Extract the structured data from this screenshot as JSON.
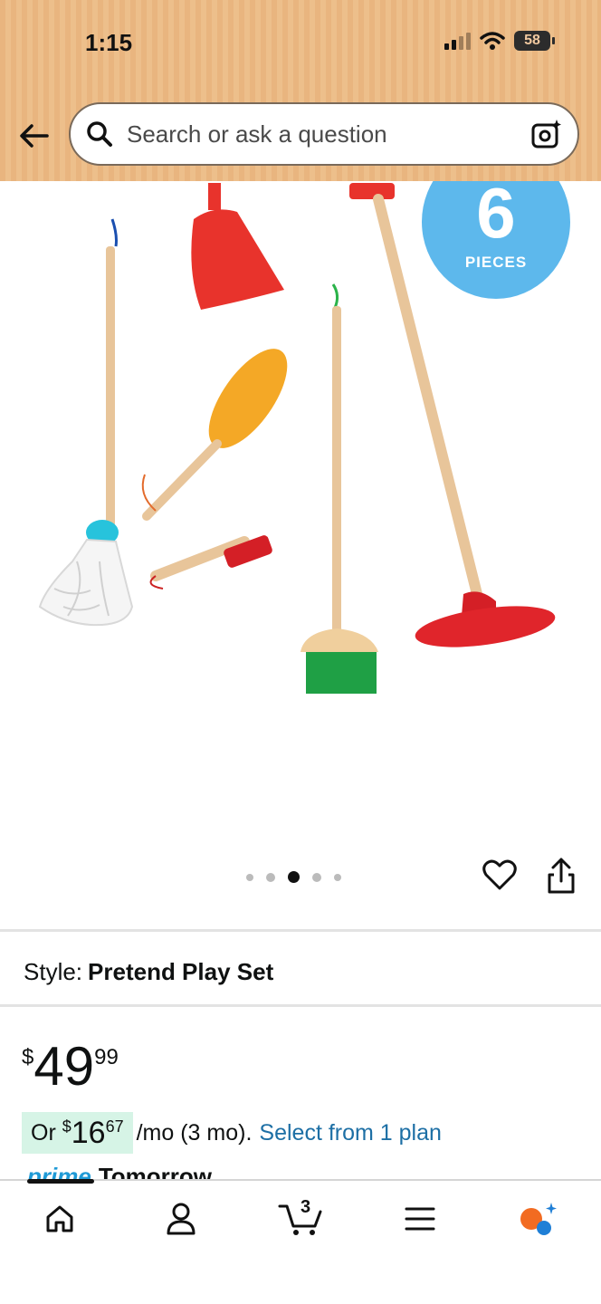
{
  "status_bar": {
    "time": "1:15",
    "battery": "58"
  },
  "search": {
    "placeholder": "Search or ask a question"
  },
  "product": {
    "badge_number": "6",
    "badge_label": "PIECES",
    "image_index": 3,
    "image_count": 5,
    "style_key": "Style:",
    "style_value": "Pretend Play Set",
    "price": {
      "currency": "$",
      "whole": "49",
      "fraction": "99"
    },
    "installment": {
      "prefix": "Or",
      "currency": "$",
      "whole": "16",
      "fraction": "67",
      "suffix": "/mo (3 mo).",
      "link": "Select from 1 plan"
    },
    "delivery": {
      "prime": "prime",
      "day": "Tomorrow"
    }
  },
  "bottom_nav": {
    "cart_count": "3"
  },
  "colors": {
    "header": "#edbf8b",
    "badge": "#5db8ec",
    "link": "#1d6fa5",
    "plan_bg": "#d6f4e6"
  }
}
